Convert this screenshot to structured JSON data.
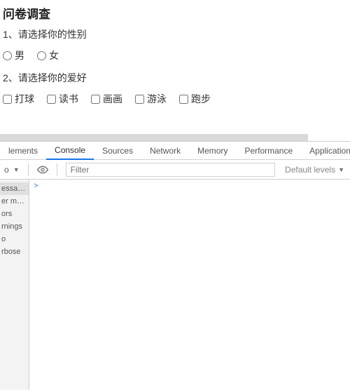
{
  "survey": {
    "title": "问卷调查",
    "q1": {
      "text": "1、请选择你的性别",
      "options": [
        "男",
        "女"
      ]
    },
    "q2": {
      "text": "2、请选择你的爱好",
      "options": [
        "打球",
        "读书",
        "画画",
        "游泳",
        "跑步"
      ]
    }
  },
  "devtools": {
    "tabs": {
      "elements": "lements",
      "console": "Console",
      "sources": "Sources",
      "network": "Network",
      "memory": "Memory",
      "performance": "Performance",
      "application": "Application"
    },
    "top_label": "o",
    "filter_placeholder": "Filter",
    "levels_label": "Default levels",
    "sidebar": {
      "messages": "essages",
      "user_messages": "er me...",
      "errors": "ors",
      "warnings": "rnings",
      "info": "o",
      "verbose": "rbose"
    },
    "prompt": ">"
  }
}
